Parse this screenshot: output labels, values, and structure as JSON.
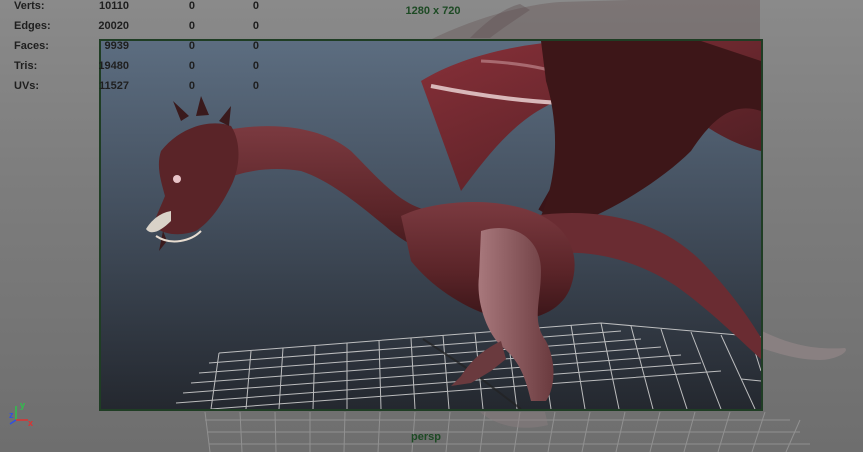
{
  "hud": {
    "rows": [
      {
        "label": "Verts:",
        "v1": "10110",
        "v2": "0",
        "v3": "0"
      },
      {
        "label": "Edges:",
        "v1": "20020",
        "v2": "0",
        "v3": "0"
      },
      {
        "label": "Faces:",
        "v1": "9939",
        "v2": "0",
        "v3": "0"
      },
      {
        "label": "Tris:",
        "v1": "19480",
        "v2": "0",
        "v3": "0"
      },
      {
        "label": "UVs:",
        "v1": "11527",
        "v2": "0",
        "v3": "0"
      }
    ]
  },
  "viewport": {
    "resolution": "1280 x 720",
    "camera": "persp"
  },
  "axis": {
    "y": "y",
    "z": "z",
    "x": "x"
  },
  "colors": {
    "hud_text": "#1f1f1f",
    "gate_border": "#1f3d24",
    "label_green": "#1d4a24",
    "dragon": "#6e2a30"
  }
}
